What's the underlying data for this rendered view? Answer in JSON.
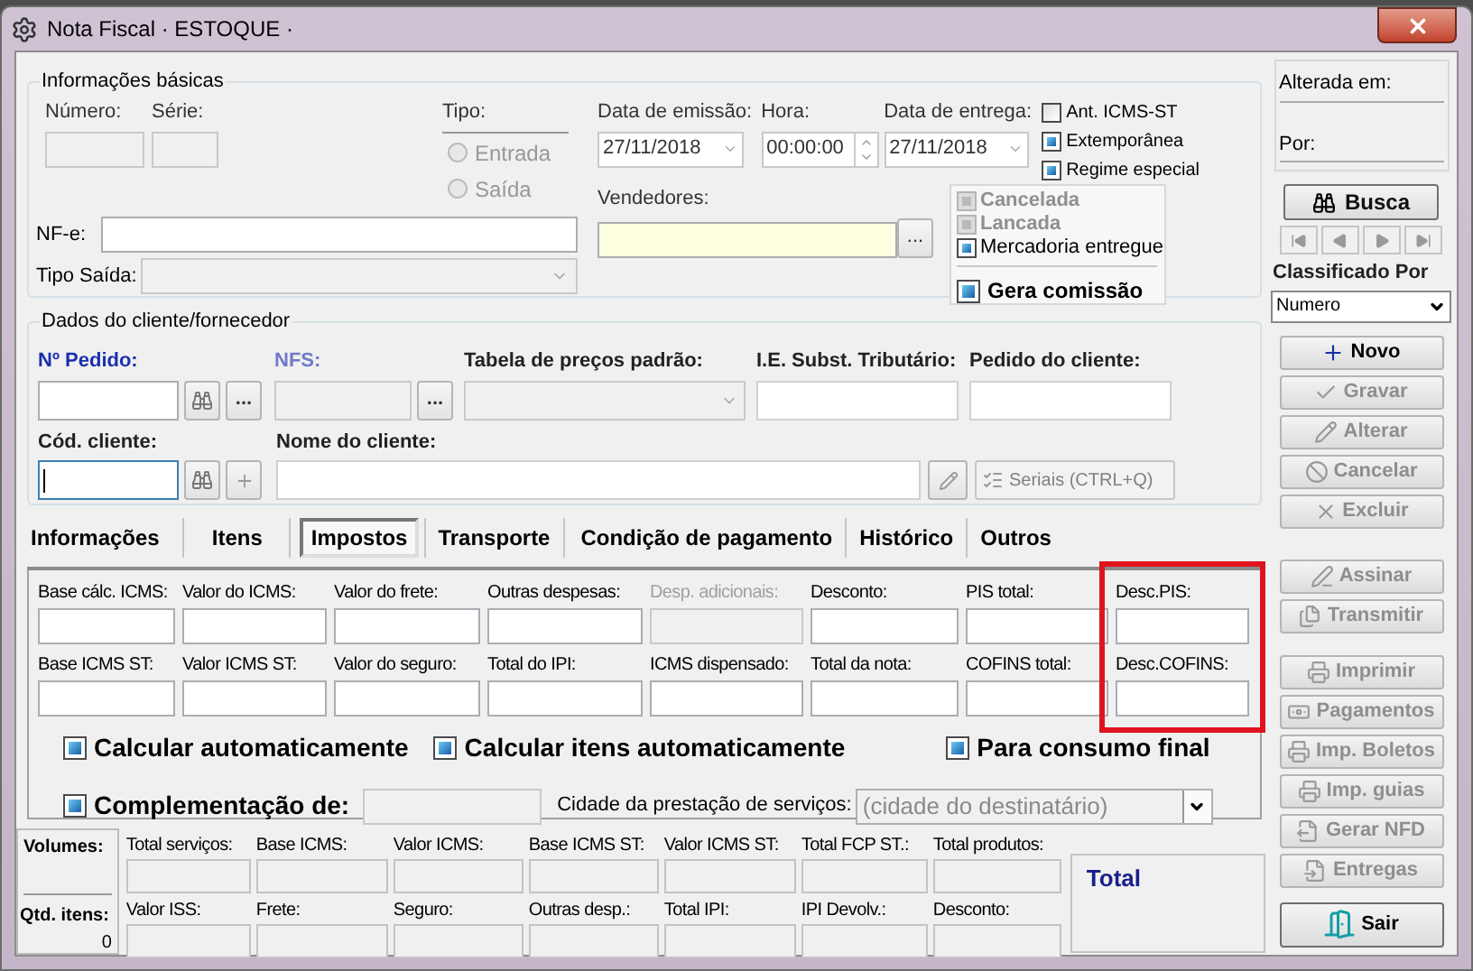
{
  "window": {
    "title": "Nota Fiscal · ESTOQUE ·"
  },
  "basic": {
    "title": "Informações básicas",
    "numero": {
      "label": "Número:"
    },
    "serie": {
      "label": "Série:"
    },
    "tipo": {
      "label": "Tipo:",
      "options": [
        {
          "label": "Entrada",
          "selected": false,
          "disabled": true
        },
        {
          "label": "Saída",
          "selected": false,
          "disabled": true
        }
      ]
    },
    "data_emissao": {
      "label": "Data de emissão:",
      "value": "27/11/2018"
    },
    "hora": {
      "label": "Hora:",
      "value": "00:00:00"
    },
    "data_entrega": {
      "label": "Data de entrega:",
      "value": "27/11/2018"
    },
    "flags": [
      {
        "label": "Ant. ICMS-ST",
        "checked": false
      },
      {
        "label": "Extemporânea",
        "checked": true
      },
      {
        "label": "Regime especial",
        "checked": true
      }
    ],
    "vendedores": {
      "label": "Vendedores:",
      "button": "..."
    },
    "status": [
      {
        "label": "Cancelada",
        "checked": false,
        "disabled": true
      },
      {
        "label": "Lancada",
        "checked": false,
        "disabled": true
      },
      {
        "label": "Mercadoria entregue",
        "checked": true,
        "disabled": false
      }
    ],
    "gera_comissao": {
      "label": "Gera comissão",
      "checked": true
    },
    "nfe": {
      "label": "NF-e:"
    },
    "tipo_saida": {
      "label": "Tipo Saída:",
      "disabled": true
    }
  },
  "cliente": {
    "title": "Dados do cliente/fornecedor",
    "pedido": {
      "label": "Nº Pedido:",
      "button": "..."
    },
    "nfs": {
      "label": "NFS:",
      "button": "...",
      "disabled": true
    },
    "tabela": {
      "label": "Tabela de preços padrão:",
      "disabled": true
    },
    "ie": {
      "label": "I.E. Subst. Tributário:"
    },
    "pedido_cliente": {
      "label": "Pedido do cliente:"
    },
    "cod_cliente": {
      "label": "Cód. cliente:",
      "focused": true
    },
    "nome_cliente": {
      "label": "Nome do cliente:"
    },
    "seriais": {
      "label": "Seriais (CTRL+Q)",
      "disabled": true
    }
  },
  "tabs": [
    {
      "label": "Informações",
      "selected": false
    },
    {
      "label": "Itens",
      "selected": false
    },
    {
      "label": "Impostos",
      "selected": true
    },
    {
      "label": "Transporte",
      "selected": false
    },
    {
      "label": "Condição de pagamento",
      "selected": false
    },
    {
      "label": "Histórico",
      "selected": false
    },
    {
      "label": "Outros",
      "selected": false
    }
  ],
  "impostos": {
    "rows": [
      {
        "fields": [
          {
            "label": "Base cálc. ICMS:",
            "disabled": false
          },
          {
            "label": "Valor do ICMS:",
            "disabled": false
          },
          {
            "label": "Valor do frete:",
            "disabled": false
          },
          {
            "label": "Outras despesas:",
            "disabled": false
          },
          {
            "label": "Desp. adicionais:",
            "disabled": true
          },
          {
            "label": "Desconto:",
            "disabled": false
          },
          {
            "label": "PIS total:",
            "disabled": false
          },
          {
            "label": "Desc.PIS:",
            "disabled": false
          }
        ]
      },
      {
        "fields": [
          {
            "label": "Base ICMS ST:",
            "disabled": false
          },
          {
            "label": "Valor ICMS ST:",
            "disabled": false
          },
          {
            "label": "Valor do seguro:",
            "disabled": false
          },
          {
            "label": "Total do IPI:",
            "disabled": false
          },
          {
            "label": "ICMS dispensado:",
            "disabled": false
          },
          {
            "label": "Total da nota:",
            "disabled": false
          },
          {
            "label": "COFINS total:",
            "disabled": false
          },
          {
            "label": "Desc.COFINS:",
            "disabled": false
          }
        ]
      }
    ],
    "options": [
      {
        "label": "Calcular automaticamente",
        "checked": true
      },
      {
        "label": "Calcular itens automaticamente",
        "checked": true
      },
      {
        "label": "Para consumo final",
        "checked": true
      }
    ],
    "complementacao": {
      "label": "Complementação de:",
      "checked": true
    },
    "cidade": {
      "label": "Cidade da prestação de serviços:",
      "value": "(cidade do destinatário)"
    }
  },
  "totals": {
    "volumes": "Volumes:",
    "qtd_label": "Qtd. itens:",
    "qtd_value": "0",
    "rows": [
      {
        "labels": [
          "Total serviços:",
          "Base ICMS:",
          "Valor ICMS:",
          "Base ICMS ST:",
          "Valor ICMS ST:",
          "Total FCP ST.:",
          "Total produtos:"
        ]
      },
      {
        "labels": [
          "Valor ISS:",
          "Frete:",
          "Seguro:",
          "Outras desp.:",
          "Total IPI:",
          "IPI Devolv.:",
          "Desconto:"
        ]
      }
    ],
    "total": "Total"
  },
  "side": {
    "alterada": "Alterada em:",
    "por": "Por:",
    "busca": "Busca",
    "classificado": "Classificado Por",
    "sort": "Numero",
    "record_buttons": [
      {
        "label": "Novo",
        "disabled": false
      },
      {
        "label": "Gravar",
        "disabled": true
      },
      {
        "label": "Alterar",
        "disabled": true
      },
      {
        "label": "Cancelar",
        "disabled": true
      },
      {
        "label": "Excluir",
        "disabled": true
      }
    ],
    "sign_buttons": [
      {
        "label": "Assinar",
        "disabled": true
      },
      {
        "label": "Transmitir",
        "disabled": true
      }
    ],
    "output_buttons": [
      {
        "label": "Imprimir",
        "disabled": true
      },
      {
        "label": "Pagamentos",
        "disabled": true
      },
      {
        "label": "Imp. Boletos",
        "disabled": true
      },
      {
        "label": "Imp. guias",
        "disabled": true
      },
      {
        "label": "Gerar NFD",
        "disabled": true
      },
      {
        "label": "Entregas",
        "disabled": true
      }
    ],
    "exit_button": {
      "label": "Sair",
      "disabled": false
    }
  }
}
